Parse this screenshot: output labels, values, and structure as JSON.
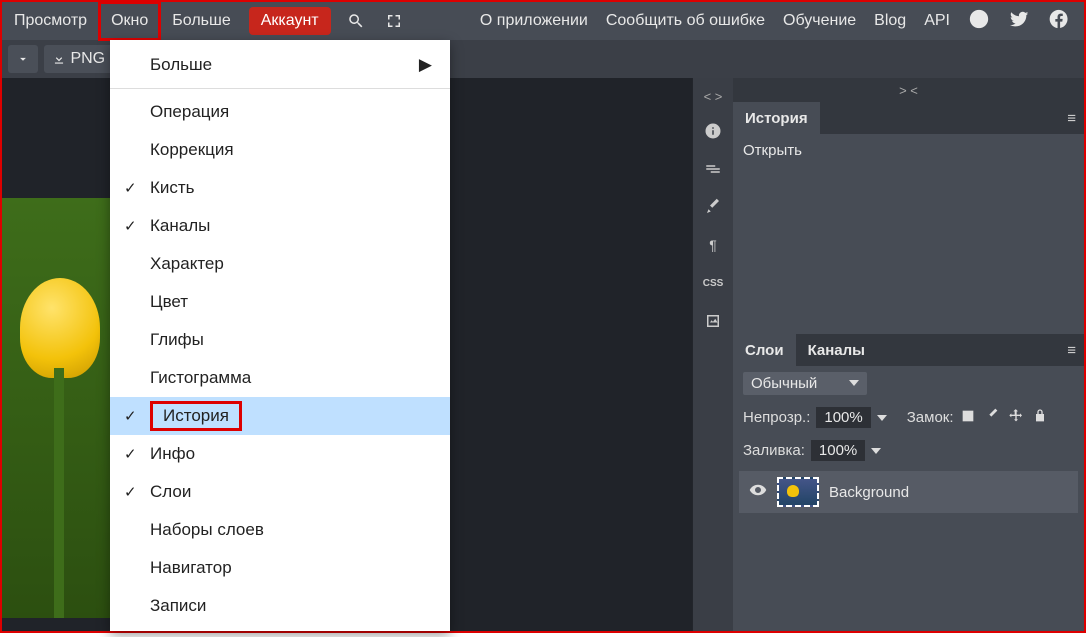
{
  "menubar": {
    "items": [
      "Просмотр",
      "Окно",
      "Больше",
      "Аккаунт"
    ],
    "right": [
      "О приложении",
      "Сообщить об ошибке",
      "Обучение",
      "Blog",
      "API"
    ]
  },
  "toolbar": {
    "png_label": "PNG"
  },
  "dropdown": {
    "header": "Больше",
    "items": [
      {
        "label": "Операция",
        "checked": false
      },
      {
        "label": "Коррекция",
        "checked": false
      },
      {
        "label": "Кисть",
        "checked": true
      },
      {
        "label": "Каналы",
        "checked": true
      },
      {
        "label": "Характер",
        "checked": false
      },
      {
        "label": "Цвет",
        "checked": false
      },
      {
        "label": "Глифы",
        "checked": false
      },
      {
        "label": "Гистограмма",
        "checked": false
      },
      {
        "label": "История",
        "checked": true,
        "selected": true
      },
      {
        "label": "Инфо",
        "checked": true
      },
      {
        "label": "Слои",
        "checked": true
      },
      {
        "label": "Наборы слоев",
        "checked": false
      },
      {
        "label": "Навигатор",
        "checked": false
      },
      {
        "label": "Записи",
        "checked": false
      }
    ]
  },
  "history_panel": {
    "title": "История",
    "entry": "Открыть"
  },
  "layers_panel": {
    "tabs": [
      "Слои",
      "Каналы"
    ],
    "blend_mode": "Обычный",
    "opacity_label": "Непрозр.:",
    "opacity_value": "100%",
    "lock_label": "Замок:",
    "fill_label": "Заливка:",
    "fill_value": "100%",
    "layer_name": "Background"
  },
  "side_tools": {
    "css": "CSS",
    "para": "¶"
  },
  "marks": {
    "left": "< >",
    "right": "> <"
  }
}
